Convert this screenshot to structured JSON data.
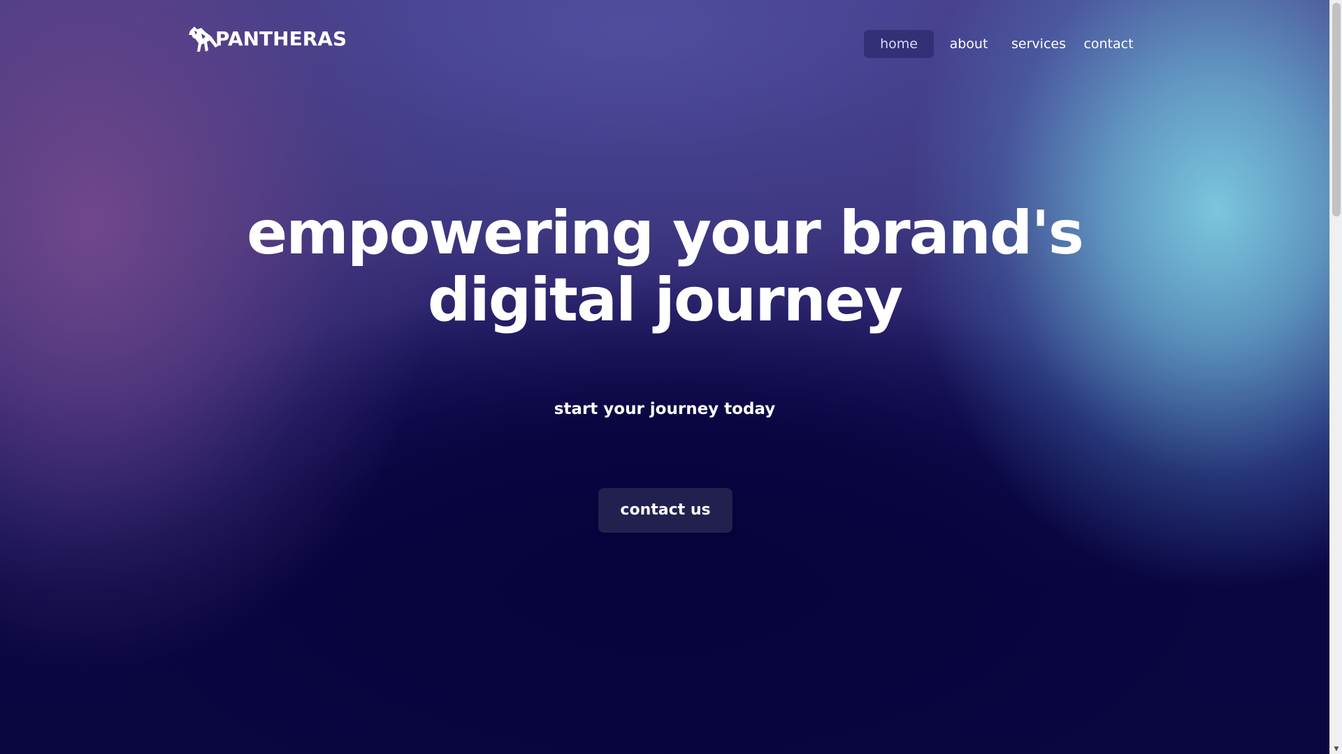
{
  "header": {
    "brand": "PANTHERAS",
    "logo_icon": "panther-icon",
    "nav": [
      {
        "label": "home",
        "active": true
      },
      {
        "label": "about",
        "active": false
      },
      {
        "label": "services",
        "active": false
      },
      {
        "label": "contact",
        "active": false
      }
    ]
  },
  "hero": {
    "headline_line1": "empowering your brand's",
    "headline_line2": "digital journey",
    "subheadline": "start your journey today",
    "cta_label": "contact us"
  },
  "colors": {
    "cta_background": "#22204e",
    "active_nav_background": "#2d2a6e",
    "text": "#ffffff",
    "accent_cyan": "#7dcee2",
    "accent_purple": "#73488c",
    "deep_navy": "#0a0640"
  },
  "scrollbar": {
    "down_arrow_icon": "chevron-down-icon"
  }
}
